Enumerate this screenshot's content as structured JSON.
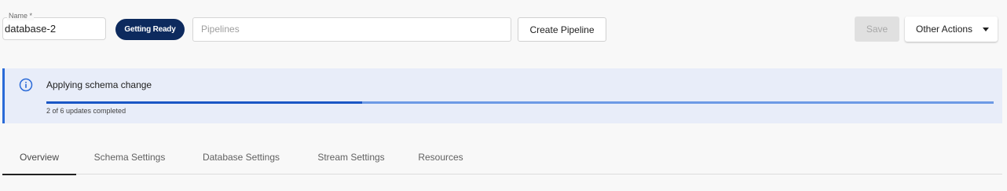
{
  "header": {
    "name_label": "Name *",
    "name_value": "database-2",
    "status": "Getting Ready",
    "pipelines_placeholder": "Pipelines",
    "create_pipeline_label": "Create Pipeline",
    "save_label": "Save",
    "other_actions_label": "Other Actions"
  },
  "banner": {
    "title": "Applying schema change",
    "progress_text": "2 of 6 updates completed",
    "progress_fraction": 0.333,
    "icon": "info-icon"
  },
  "tabs": [
    {
      "label": "Overview",
      "active": true
    },
    {
      "label": "Schema Settings",
      "active": false
    },
    {
      "label": "Database Settings",
      "active": false
    },
    {
      "label": "Stream Settings",
      "active": false
    },
    {
      "label": "Resources",
      "active": false
    }
  ],
  "colors": {
    "status_pill": "#0d2a5e",
    "banner_bg": "#e8edf9",
    "banner_accent": "#2a6ad8",
    "progress_fill": "#1a56c5",
    "progress_track": "#6c9ae6"
  }
}
